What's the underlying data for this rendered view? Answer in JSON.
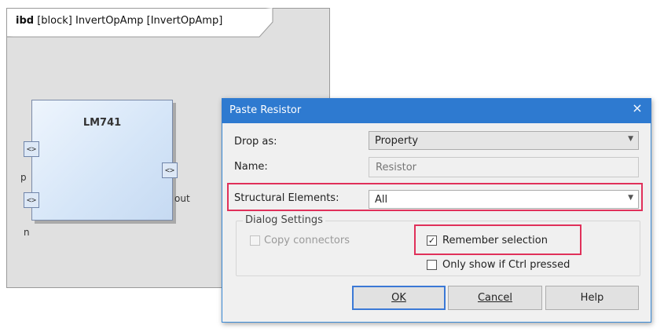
{
  "diagram": {
    "frame_kind": "ibd",
    "frame_name": "[block] InvertOpAmp [InvertOpAmp]",
    "block_name": "LM741",
    "ports": [
      {
        "label": "p",
        "glyph": "<>"
      },
      {
        "label": "n",
        "glyph": "<>"
      },
      {
        "label": "out",
        "glyph": "<>"
      }
    ]
  },
  "dialog": {
    "title": "Paste Resistor",
    "close_icon": "×",
    "drop_as": {
      "label": "Drop as:",
      "value": "Property"
    },
    "name": {
      "label": "Name:",
      "placeholder": "Resistor"
    },
    "structural": {
      "label": "Structural Elements:",
      "value": "All"
    },
    "settings_group": "Dialog Settings",
    "copy_connectors": {
      "label": "Copy connectors",
      "checked": false,
      "enabled": false
    },
    "remember_selection": {
      "label": "Remember selection",
      "checked": true
    },
    "only_ctrl": {
      "label": "Only show if Ctrl pressed",
      "checked": false
    },
    "buttons": {
      "ok": "OK",
      "cancel": "Cancel",
      "help": "Help"
    },
    "highlight_color": "#e0305a",
    "accent_color": "#2e7ad0"
  }
}
